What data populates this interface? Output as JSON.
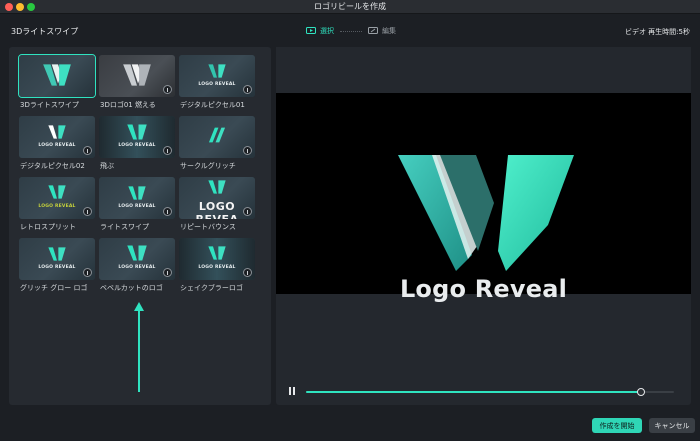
{
  "window": {
    "title": "ロゴリビールを作成"
  },
  "header": {
    "selected_template": "3Dライトスワイプ",
    "steps": [
      {
        "label": "選択"
      },
      {
        "label": "編集"
      }
    ],
    "duration": "ビデオ 再生時間:5秒"
  },
  "templates": [
    {
      "label": "3Dライトスワイプ",
      "thumb_text": ""
    },
    {
      "label": "3Dロゴ01 燃える",
      "thumb_text": ""
    },
    {
      "label": "デジタルピクセル01",
      "thumb_text": "LOGO REVEAL"
    },
    {
      "label": "デジタルピクセル02",
      "thumb_text": "LOGO REVEAL"
    },
    {
      "label": "飛ぶ",
      "thumb_text": "LOGO REVEAL"
    },
    {
      "label": "サークルグリッチ",
      "thumb_text": ""
    },
    {
      "label": "レトロスプリット",
      "thumb_text": "LOGO REVEAL"
    },
    {
      "label": "ライトスワイプ",
      "thumb_text": "LOGO REVEAL"
    },
    {
      "label": "リピートバウンス",
      "thumb_text": "LOGO REVEA"
    },
    {
      "label": "グリッチ グロー ロゴ",
      "thumb_text": "LOGO REVEAL"
    },
    {
      "label": "ベベルカットのロゴ",
      "thumb_text": "LOGO REVEAL"
    },
    {
      "label": "シェイクブラーロゴ",
      "thumb_text": "LOGO REVEAL"
    }
  ],
  "preview": {
    "title": "Logo Reveal",
    "progress": 0.91
  },
  "footer": {
    "start_label": "作成を開始",
    "cancel_label": "キャンセル"
  },
  "colors": {
    "accent": "#2fe3c0",
    "background": "#1c1f24",
    "panel": "#262a30"
  }
}
